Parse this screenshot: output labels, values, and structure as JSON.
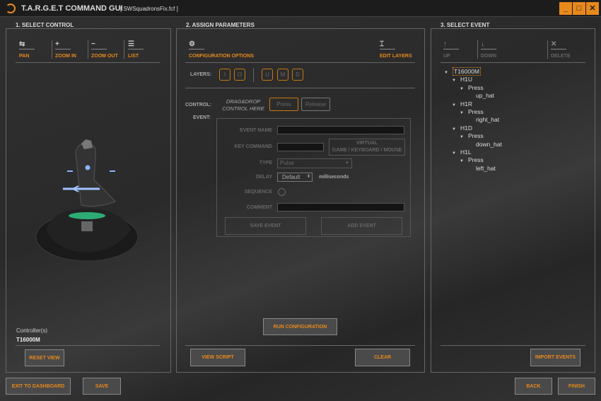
{
  "app": {
    "title": "T.A.R.G.E.T COMMAND GUI",
    "file": "[ SWSquadronsFix.fcf ]",
    "minimize": "_",
    "maximize": "□",
    "close": "✕"
  },
  "select_control": {
    "heading": "1. SELECT CONTROL",
    "tools": [
      "PAN",
      "ZOOM IN",
      "ZOOM OUT",
      "LIST"
    ],
    "controllers_label": "Controller(s)",
    "controller": "T16000M",
    "reset_view": "RESET VIEW"
  },
  "assign": {
    "heading": "2. ASSIGN PARAMETERS",
    "config_options": "CONFIGURATION OPTIONS",
    "edit_layers": "EDIT LAYERS",
    "layers_label": "LAYERS:",
    "layers": [
      "I",
      "O",
      "U",
      "M",
      "D"
    ],
    "control_label": "CONTROL:",
    "drag_drop_1": "DRAG&DROP",
    "drag_drop_2": "CONTROL HERE",
    "press": "Press",
    "release": "Release",
    "event_label": "EVENT:",
    "event_name": "EVENT NAME",
    "key_command": "KEY COMMAND",
    "virtual_1": "VIRTUAL",
    "virtual_2": "GAME / KEYBOARD / MOUSE",
    "type": "TYPE",
    "type_value": "Pulse",
    "delay": "DELAY",
    "delay_value": "Default",
    "milliseconds": "milliseconds",
    "sequence": "SEQUENCE",
    "comment": "COMMENT",
    "save_event": "SAVE EVENT",
    "add_event": "ADD EVENT",
    "run_configuration": "RUN CONFIGURATION",
    "view_script": "VIEW SCRIPT",
    "clear": "CLEAR"
  },
  "select_event": {
    "heading": "3. SELECT EVENT",
    "tools": [
      "UP",
      "DOWN",
      "DELETE"
    ],
    "import_events": "IMPORT EVENTS",
    "tree": {
      "root": "T16000M",
      "items": [
        {
          "hat": "H1U",
          "action": "Press",
          "key": "up_hat"
        },
        {
          "hat": "H1R",
          "action": "Press",
          "key": "right_hat"
        },
        {
          "hat": "H1D",
          "action": "Press",
          "key": "down_hat"
        },
        {
          "hat": "H1L",
          "action": "Press",
          "key": "left_hat"
        }
      ]
    }
  },
  "footer": {
    "exit": "EXIT TO DASHBOARD",
    "save": "SAVE",
    "back": "BACK",
    "finish": "FINISH"
  }
}
